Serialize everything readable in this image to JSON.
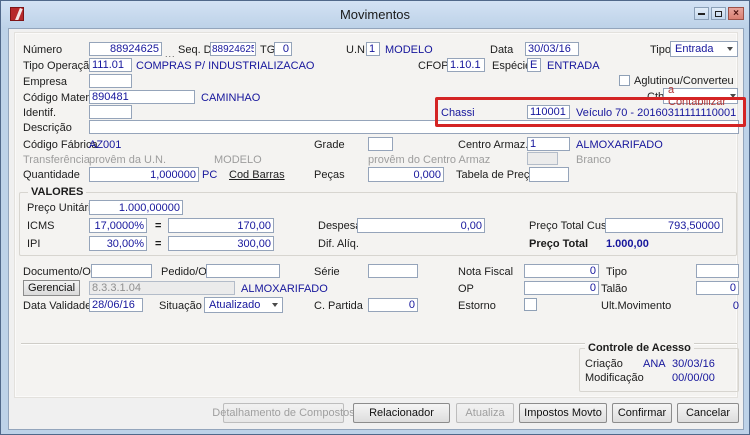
{
  "window": {
    "title": "Movimentos",
    "controls": {
      "minimize": "minimize",
      "maximize": "maximize",
      "close": "close"
    }
  },
  "colors": {
    "highlight_red": "#d42424",
    "value_navy": "#16169c",
    "ctb_red": "#b03434"
  },
  "fields": {
    "numero": {
      "label": "Número",
      "value": "88924625",
      "browse": "..."
    },
    "seq_dia": {
      "label": "Seq. Dia",
      "value": "88924625"
    },
    "tg": {
      "label": "TG",
      "value": "0"
    },
    "un": {
      "label": "U.N.",
      "value": "1",
      "desc": "MODELO"
    },
    "data": {
      "label": "Data",
      "value": "30/03/16"
    },
    "tipo": {
      "label": "Tipo",
      "value": "Entrada"
    },
    "tipo_operacao": {
      "label": "Tipo Operação",
      "value": "111.01",
      "desc": "COMPRAS P/ INDUSTRIALIZACAO"
    },
    "cfop": {
      "label": "CFOP",
      "value": "1.10.1"
    },
    "especie": {
      "label": "Espécie",
      "value": "E",
      "desc": "ENTRADA"
    },
    "empresa": {
      "label": "Empresa",
      "value": ""
    },
    "aglutinou": {
      "label": "Aglutinou/Converteu"
    },
    "codigo_material": {
      "label": "Código Material",
      "value": "890481",
      "desc": "CAMINHAO"
    },
    "ctb": {
      "label": "Ctb",
      "value": "a Contabilizar"
    },
    "identif": {
      "label": "Identif.",
      "value": ""
    },
    "chassi": {
      "label": "Chassi",
      "value": "110001",
      "desc": "Veículo 70 - 20160311111110001"
    },
    "descricao": {
      "label": "Descrição",
      "value": ""
    },
    "codigo_fabrica": {
      "label": "Código Fábrica",
      "value": "AZ001"
    },
    "grade": {
      "label": "Grade",
      "value": ""
    },
    "centro_armaz": {
      "label": "Centro Armaz.",
      "value": "1",
      "desc": "ALMOXARIFADO"
    },
    "transferencia": {
      "label": "Transferência",
      "un_text": "provêm da U.N.",
      "un_value": "MODELO",
      "ca_text": "provêm do Centro Armaz",
      "ca_value": "Branco"
    },
    "quantidade": {
      "label": "Quantidade",
      "value": "1,000000",
      "unit": "PC"
    },
    "cod_barras": {
      "label": "Cod Barras"
    },
    "pecas": {
      "label": "Peças",
      "value": "0,000"
    },
    "tabela_preco": {
      "label": "Tabela de Preço",
      "value": ""
    },
    "documento": {
      "label": "Documento/O.S",
      "value": ""
    },
    "pedido": {
      "label": "Pedido/OC",
      "value": ""
    },
    "serie": {
      "label": "Série",
      "value": ""
    },
    "nota_fiscal": {
      "label": "Nota Fiscal",
      "value": "0"
    },
    "tipo_doc": {
      "label": "Tipo",
      "value": ""
    },
    "gerencial": {
      "key": "G",
      "post": "erencial",
      "value": "8.3.3.1.04",
      "desc": "ALMOXARIFADO"
    },
    "op": {
      "label": "OP",
      "value": "0"
    },
    "talao": {
      "label": "Talão",
      "value": "0"
    },
    "data_validade": {
      "label": "Data Validade",
      "value": "28/06/16"
    },
    "situacao": {
      "label": "Situação",
      "value": "Atualizado"
    },
    "c_partida": {
      "label": "C. Partida",
      "value": "0"
    },
    "estorno": {
      "label": "Estorno"
    },
    "ult_movimento": {
      "label": "Ult.Movimento",
      "value": "0"
    }
  },
  "valores": {
    "title": "VALORES",
    "preco_unitario": {
      "label": "Preço Unitário",
      "value": "1.000,00000"
    },
    "icms": {
      "label": "ICMS",
      "pct": "17,0000%",
      "eq": "=",
      "value": "170,00"
    },
    "ipi": {
      "label": "IPI",
      "pct": "30,00%",
      "eq": "=",
      "value": "300,00"
    },
    "despesas": {
      "label": "Despesas",
      "value": "0,00"
    },
    "dif_aliq": {
      "label": "Dif. Alíq."
    },
    "preco_total_custo": {
      "label": "Preço Total Custo",
      "value": "793,50000"
    },
    "preco_total": {
      "label": "Preço Total",
      "value": "1.000,00"
    }
  },
  "acesso": {
    "title": "Controle de Acesso",
    "criacao_label": "Criação",
    "criacao_user": "ANA",
    "criacao_date": "30/03/16",
    "modificacao_label": "Modificação",
    "modificacao_date": "00/00/00"
  },
  "buttons": {
    "detalhamento": {
      "pre": "",
      "key": "D",
      "post": "etalhamento de Compostos"
    },
    "relacionador": {
      "pre": "",
      "key": "R",
      "post": "elacionador"
    },
    "atualiza": {
      "pre": "",
      "key": "A",
      "post": "tualiza"
    },
    "impostos": {
      "pre": "",
      "key": "I",
      "post": "mpostos Movto"
    },
    "confirmar": {
      "pre": "",
      "key": "C",
      "post": "onfirmar"
    },
    "cancelar": {
      "pre": "Cancela",
      "key": "r",
      "post": ""
    }
  }
}
